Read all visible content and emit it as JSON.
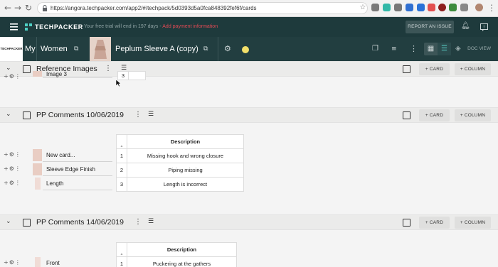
{
  "browser": {
    "url": "https://angora.techpacker.com/app2/#/techpack/5d0393d5a0fca848392fef6f/cards"
  },
  "app": {
    "brand": "TECHPACKER",
    "trial_text": "Your free trial will end in 197 days",
    "trial_link": "Add payment information",
    "report_button": "REPORT AN ISSUE"
  },
  "techpack": {
    "logo_text": "TECHPACKER",
    "crumb_1": "My",
    "crumb_2": "Women",
    "name": "Peplum Sleeve A (copy)",
    "doc_view": "DOC VIEW"
  },
  "buttons": {
    "card": "+ CARD",
    "column": "+ COLUMN"
  },
  "sections": [
    {
      "title": "Reference Images",
      "rows": [
        {
          "label": "Image 3"
        }
      ],
      "table_rows": [
        {
          "num": "3",
          "desc": ""
        }
      ]
    },
    {
      "title": "PP Comments 10/06/2019",
      "rows": [
        {
          "label": "New card..."
        },
        {
          "label": "Sleeve Edge Finish"
        },
        {
          "label": "Length"
        }
      ],
      "table_header": "Description",
      "table_rows": [
        {
          "num": "1",
          "desc": "Missing hook and wrong closure"
        },
        {
          "num": "2",
          "desc": "Piping missing"
        },
        {
          "num": "3",
          "desc": "Length is incorrect"
        }
      ]
    },
    {
      "title": "PP Comments 14/06/2019",
      "rows": [
        {
          "label": "Front"
        }
      ],
      "table_header": "Description",
      "table_rows": [
        {
          "num": "1",
          "desc": "Puckering at the gathers"
        }
      ]
    }
  ]
}
